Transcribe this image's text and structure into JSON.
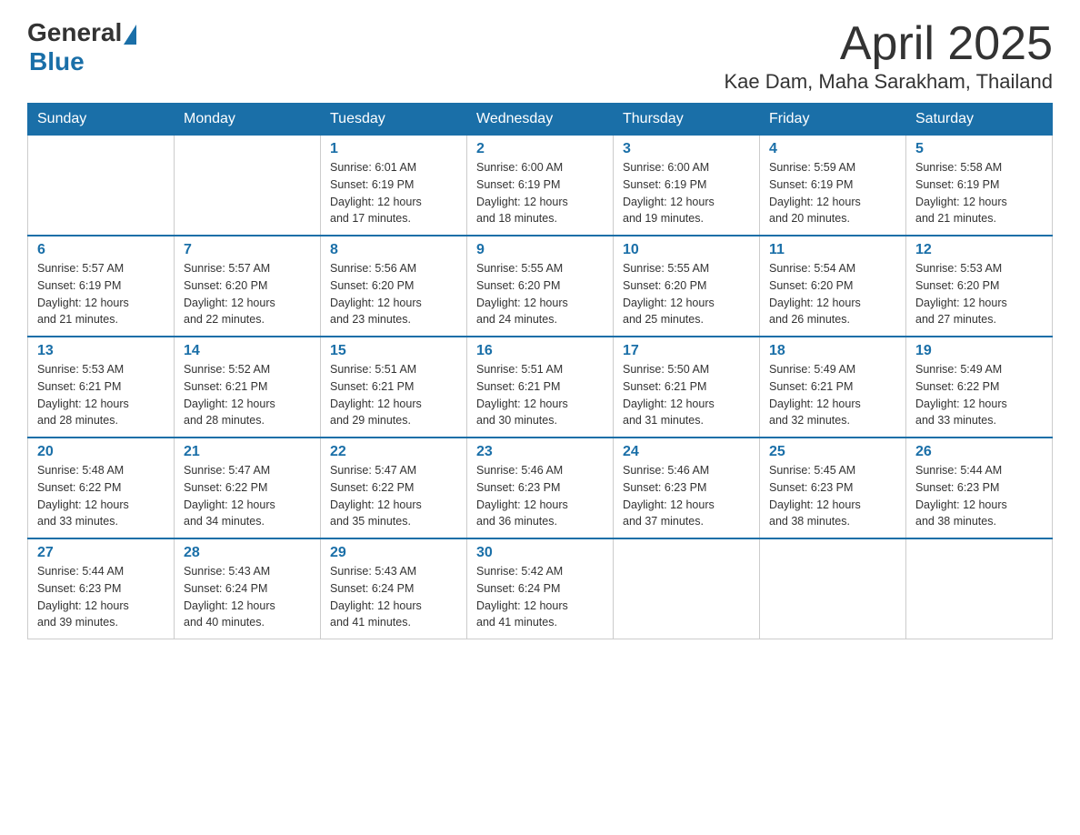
{
  "logo": {
    "general": "General",
    "blue": "Blue"
  },
  "title": "April 2025",
  "location": "Kae Dam, Maha Sarakham, Thailand",
  "days_of_week": [
    "Sunday",
    "Monday",
    "Tuesday",
    "Wednesday",
    "Thursday",
    "Friday",
    "Saturday"
  ],
  "weeks": [
    [
      {
        "day": "",
        "info": ""
      },
      {
        "day": "",
        "info": ""
      },
      {
        "day": "1",
        "info": "Sunrise: 6:01 AM\nSunset: 6:19 PM\nDaylight: 12 hours\nand 17 minutes."
      },
      {
        "day": "2",
        "info": "Sunrise: 6:00 AM\nSunset: 6:19 PM\nDaylight: 12 hours\nand 18 minutes."
      },
      {
        "day": "3",
        "info": "Sunrise: 6:00 AM\nSunset: 6:19 PM\nDaylight: 12 hours\nand 19 minutes."
      },
      {
        "day": "4",
        "info": "Sunrise: 5:59 AM\nSunset: 6:19 PM\nDaylight: 12 hours\nand 20 minutes."
      },
      {
        "day": "5",
        "info": "Sunrise: 5:58 AM\nSunset: 6:19 PM\nDaylight: 12 hours\nand 21 minutes."
      }
    ],
    [
      {
        "day": "6",
        "info": "Sunrise: 5:57 AM\nSunset: 6:19 PM\nDaylight: 12 hours\nand 21 minutes."
      },
      {
        "day": "7",
        "info": "Sunrise: 5:57 AM\nSunset: 6:20 PM\nDaylight: 12 hours\nand 22 minutes."
      },
      {
        "day": "8",
        "info": "Sunrise: 5:56 AM\nSunset: 6:20 PM\nDaylight: 12 hours\nand 23 minutes."
      },
      {
        "day": "9",
        "info": "Sunrise: 5:55 AM\nSunset: 6:20 PM\nDaylight: 12 hours\nand 24 minutes."
      },
      {
        "day": "10",
        "info": "Sunrise: 5:55 AM\nSunset: 6:20 PM\nDaylight: 12 hours\nand 25 minutes."
      },
      {
        "day": "11",
        "info": "Sunrise: 5:54 AM\nSunset: 6:20 PM\nDaylight: 12 hours\nand 26 minutes."
      },
      {
        "day": "12",
        "info": "Sunrise: 5:53 AM\nSunset: 6:20 PM\nDaylight: 12 hours\nand 27 minutes."
      }
    ],
    [
      {
        "day": "13",
        "info": "Sunrise: 5:53 AM\nSunset: 6:21 PM\nDaylight: 12 hours\nand 28 minutes."
      },
      {
        "day": "14",
        "info": "Sunrise: 5:52 AM\nSunset: 6:21 PM\nDaylight: 12 hours\nand 28 minutes."
      },
      {
        "day": "15",
        "info": "Sunrise: 5:51 AM\nSunset: 6:21 PM\nDaylight: 12 hours\nand 29 minutes."
      },
      {
        "day": "16",
        "info": "Sunrise: 5:51 AM\nSunset: 6:21 PM\nDaylight: 12 hours\nand 30 minutes."
      },
      {
        "day": "17",
        "info": "Sunrise: 5:50 AM\nSunset: 6:21 PM\nDaylight: 12 hours\nand 31 minutes."
      },
      {
        "day": "18",
        "info": "Sunrise: 5:49 AM\nSunset: 6:21 PM\nDaylight: 12 hours\nand 32 minutes."
      },
      {
        "day": "19",
        "info": "Sunrise: 5:49 AM\nSunset: 6:22 PM\nDaylight: 12 hours\nand 33 minutes."
      }
    ],
    [
      {
        "day": "20",
        "info": "Sunrise: 5:48 AM\nSunset: 6:22 PM\nDaylight: 12 hours\nand 33 minutes."
      },
      {
        "day": "21",
        "info": "Sunrise: 5:47 AM\nSunset: 6:22 PM\nDaylight: 12 hours\nand 34 minutes."
      },
      {
        "day": "22",
        "info": "Sunrise: 5:47 AM\nSunset: 6:22 PM\nDaylight: 12 hours\nand 35 minutes."
      },
      {
        "day": "23",
        "info": "Sunrise: 5:46 AM\nSunset: 6:23 PM\nDaylight: 12 hours\nand 36 minutes."
      },
      {
        "day": "24",
        "info": "Sunrise: 5:46 AM\nSunset: 6:23 PM\nDaylight: 12 hours\nand 37 minutes."
      },
      {
        "day": "25",
        "info": "Sunrise: 5:45 AM\nSunset: 6:23 PM\nDaylight: 12 hours\nand 38 minutes."
      },
      {
        "day": "26",
        "info": "Sunrise: 5:44 AM\nSunset: 6:23 PM\nDaylight: 12 hours\nand 38 minutes."
      }
    ],
    [
      {
        "day": "27",
        "info": "Sunrise: 5:44 AM\nSunset: 6:23 PM\nDaylight: 12 hours\nand 39 minutes."
      },
      {
        "day": "28",
        "info": "Sunrise: 5:43 AM\nSunset: 6:24 PM\nDaylight: 12 hours\nand 40 minutes."
      },
      {
        "day": "29",
        "info": "Sunrise: 5:43 AM\nSunset: 6:24 PM\nDaylight: 12 hours\nand 41 minutes."
      },
      {
        "day": "30",
        "info": "Sunrise: 5:42 AM\nSunset: 6:24 PM\nDaylight: 12 hours\nand 41 minutes."
      },
      {
        "day": "",
        "info": ""
      },
      {
        "day": "",
        "info": ""
      },
      {
        "day": "",
        "info": ""
      }
    ]
  ]
}
